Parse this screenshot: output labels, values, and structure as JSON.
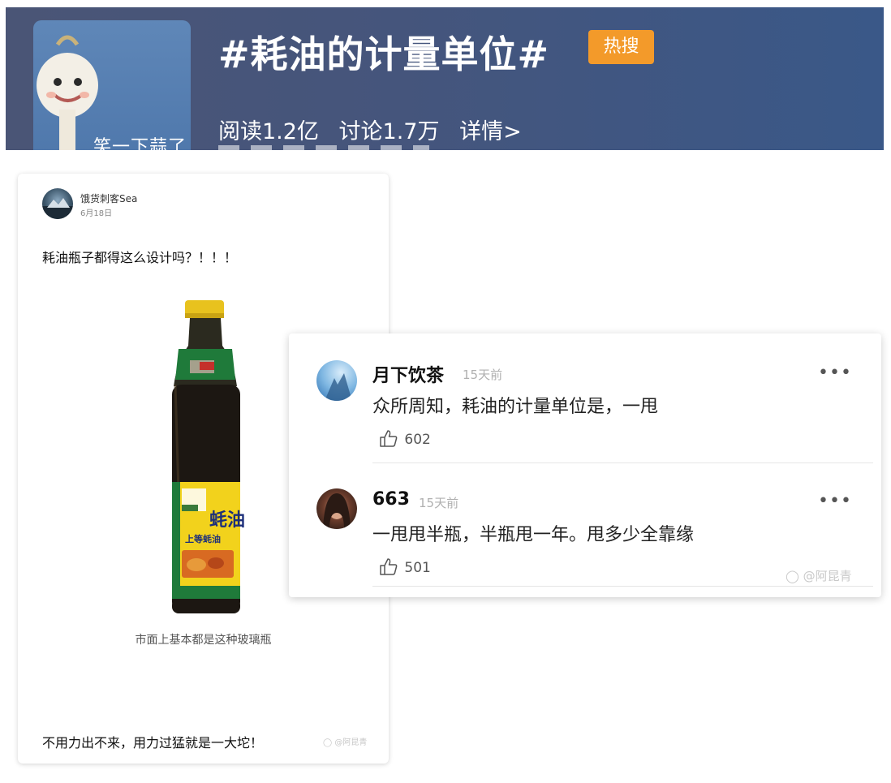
{
  "topic": {
    "title": "#耗油的计量单位#",
    "badge": "热搜",
    "avatar_caption": "笑一下蒜了",
    "stats": {
      "read": "阅读1.2亿",
      "discuss": "讨论1.7万",
      "detail": "详情>"
    }
  },
  "post": {
    "username": "饿货刺客Sea",
    "date": "6月18日",
    "text": "耗油瓶子都得这么设计吗？！！！",
    "bottle_label": {
      "brand_main": "蚝油",
      "brand_sub": "上等蚝油"
    },
    "image_caption": "市面上基本都是这种玻璃瓶",
    "footer": "不用力出不来，用力过猛就是一大坨！",
    "watermark": "@阿昆青"
  },
  "comments": [
    {
      "name": "月下饮茶",
      "time": "15天前",
      "text": "众所周知，耗油的计量单位是，一甩",
      "likes": "602"
    },
    {
      "name": "663",
      "time": "15天前",
      "text": "一甩甩半瓶，半瓶甩一年。甩多少全靠缘",
      "likes": "501"
    }
  ],
  "comment_watermark": "@阿昆青",
  "icons": {
    "like": "thumbs-up-icon",
    "more": "more-dots-icon",
    "weibo": "weibo-logo-icon"
  },
  "colors": {
    "banner": "#45557c",
    "badge": "#f39a2a"
  }
}
